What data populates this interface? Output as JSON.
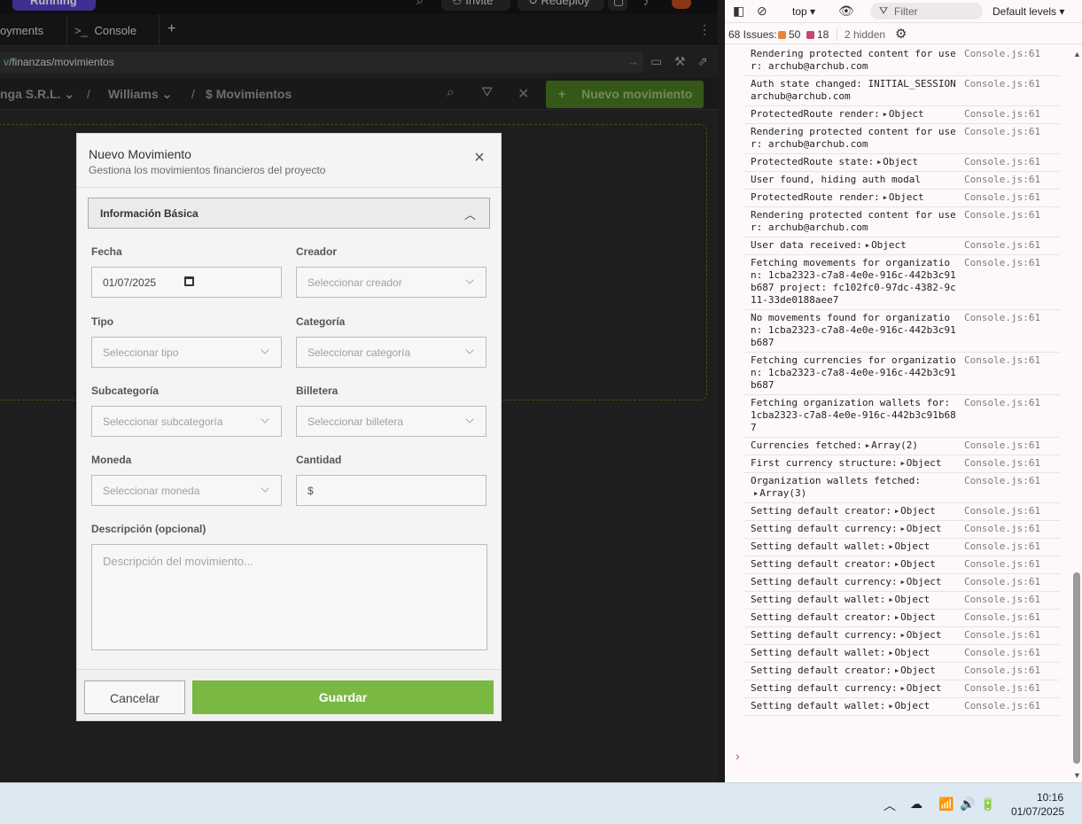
{
  "app": {
    "status_badge": "Running",
    "invite_label": "Invite",
    "redeploy_label": "Redeploy",
    "tabs": [
      {
        "label": "oyments"
      },
      {
        "label": "Console",
        "icon": ">_"
      },
      {
        "label": "+"
      }
    ],
    "url": {
      "prefix": "v",
      "path": "/finanzas/movimientos"
    },
    "breadcrumb": {
      "org": "nga S.R.L.",
      "project": "Williams",
      "page_icon": "$",
      "page": "Movimientos"
    },
    "new_movement_label": "Nuevo movimiento"
  },
  "modal": {
    "title": "Nuevo Movimiento",
    "subtitle": "Gestiona los movimientos financieros del proyecto",
    "section_title": "Información Básica",
    "fields": {
      "fecha": {
        "label": "Fecha",
        "value": "01/07/2025"
      },
      "creador": {
        "label": "Creador",
        "placeholder": "Seleccionar creador"
      },
      "tipo": {
        "label": "Tipo",
        "placeholder": "Seleccionar tipo"
      },
      "categoria": {
        "label": "Categoría",
        "placeholder": "Seleccionar categoría"
      },
      "subcategoria": {
        "label": "Subcategoría",
        "placeholder": "Seleccionar subcategoría"
      },
      "billetera": {
        "label": "Billetera",
        "placeholder": "Seleccionar billetera"
      },
      "moneda": {
        "label": "Moneda",
        "placeholder": "Seleccionar moneda"
      },
      "cantidad": {
        "label": "Cantidad",
        "prefix": "$"
      },
      "descripcion": {
        "label": "Descripción (opcional)",
        "placeholder": "Descripción del movimiento..."
      }
    },
    "cancel_label": "Cancelar",
    "save_label": "Guardar"
  },
  "devtools": {
    "context": "top",
    "filter_placeholder": "Filter",
    "levels": "Default levels",
    "issues_label": "68 Issues:",
    "issues_warn": "50",
    "issues_info": "18",
    "hidden_label": "2 hidden",
    "logs": [
      {
        "msg": "Rendering protected content for user: archub@archub.com",
        "src": "Console.js:61"
      },
      {
        "msg": "Auth state changed: INITIAL_SESSION archub@archub.com",
        "src": "Console.js:61"
      },
      {
        "msg": "ProtectedRoute render:",
        "obj": "Object",
        "src": "Console.js:61"
      },
      {
        "msg": "Rendering protected content for user: archub@archub.com",
        "src": "Console.js:61"
      },
      {
        "msg": "ProtectedRoute state:",
        "obj": "Object",
        "src": "Console.js:61"
      },
      {
        "msg": "User found, hiding auth modal",
        "src": "Console.js:61"
      },
      {
        "msg": "ProtectedRoute render:",
        "obj": "Object",
        "src": "Console.js:61"
      },
      {
        "msg": "Rendering protected content for user: archub@archub.com",
        "src": "Console.js:61"
      },
      {
        "msg": "User data received:",
        "obj": "Object",
        "src": "Console.js:61"
      },
      {
        "msg": "Fetching movements for organization: 1cba2323-c7a8-4e0e-916c-442b3c91b687 project: fc102fc0-97dc-4382-9c11-33de0188aee7",
        "src": "Console.js:61"
      },
      {
        "msg": "No movements found for organization: 1cba2323-c7a8-4e0e-916c-442b3c91b687",
        "src": "Console.js:61"
      },
      {
        "msg": "Fetching currencies for organization: 1cba2323-c7a8-4e0e-916c-442b3c91b687",
        "src": "Console.js:61"
      },
      {
        "msg": "Fetching organization wallets for: 1cba2323-c7a8-4e0e-916c-442b3c91b687",
        "src": "Console.js:61"
      },
      {
        "msg": "Currencies fetched:",
        "obj": "Array(2)",
        "src": "Console.js:61"
      },
      {
        "msg": "First currency structure:",
        "obj": "Object",
        "src": "Console.js:61"
      },
      {
        "msg": "Organization wallets fetched:",
        "obj": "Array(3)",
        "src": "Console.js:61"
      },
      {
        "msg": "Setting default creator:",
        "obj": "Object",
        "src": "Console.js:61"
      },
      {
        "msg": "Setting default currency:",
        "obj": "Object",
        "src": "Console.js:61"
      },
      {
        "msg": "Setting default wallet:",
        "obj": "Object",
        "src": "Console.js:61"
      },
      {
        "msg": "Setting default creator:",
        "obj": "Object",
        "src": "Console.js:61"
      },
      {
        "msg": "Setting default currency:",
        "obj": "Object",
        "src": "Console.js:61"
      },
      {
        "msg": "Setting default wallet:",
        "obj": "Object",
        "src": "Console.js:61"
      },
      {
        "msg": "Setting default creator:",
        "obj": "Object",
        "src": "Console.js:61"
      },
      {
        "msg": "Setting default currency:",
        "obj": "Object",
        "src": "Console.js:61"
      },
      {
        "msg": "Setting default wallet:",
        "obj": "Object",
        "src": "Console.js:61"
      },
      {
        "msg": "Setting default creator:",
        "obj": "Object",
        "src": "Console.js:61"
      },
      {
        "msg": "Setting default currency:",
        "obj": "Object",
        "src": "Console.js:61"
      },
      {
        "msg": "Setting default wallet:",
        "obj": "Object",
        "src": "Console.js:61"
      }
    ]
  },
  "taskbar": {
    "time": "10:16",
    "date": "01/07/2025"
  },
  "colors": {
    "save_green": "#78b843",
    "new_movement_green": "#4a7a22",
    "running_purple": "#5b40c9"
  }
}
